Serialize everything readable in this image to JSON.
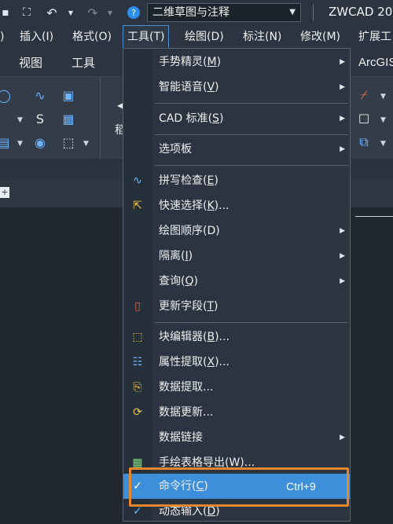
{
  "titlebar": {
    "workspace": "二维草图与注释",
    "app_title": "ZWCAD 20"
  },
  "menubar": {
    "items": [
      {
        "label": "插入(I)"
      },
      {
        "label": "格式(O)"
      },
      {
        "label": "工具(T)"
      },
      {
        "label": "绘图(D)"
      },
      {
        "label": "标注(N)"
      },
      {
        "label": "修改(M)"
      },
      {
        "label": "扩展工"
      }
    ]
  },
  "ribbon": {
    "tabs": [
      {
        "label": "视图"
      },
      {
        "label": "工具"
      },
      {
        "label": "ArcGIS"
      }
    ],
    "partial_label": "稻"
  },
  "tools_menu": {
    "items": [
      {
        "pre": "手势精灵(",
        "key": "M",
        "post": ")",
        "submenu": true
      },
      {
        "pre": "智能语音(",
        "key": "V",
        "post": ")",
        "submenu": true
      },
      {
        "pre": "CAD 标准(",
        "key": "S",
        "post": ")",
        "submenu": true
      },
      {
        "pre": "选项板",
        "key": "",
        "post": "",
        "submenu": true
      },
      {
        "pre": "拼写检查(",
        "key": "E",
        "post": ")",
        "icon": "spell-check-icon"
      },
      {
        "pre": "快速选择(",
        "key": "K",
        "post": ")...",
        "icon": "quick-select-icon"
      },
      {
        "pre": "绘图顺序(D)",
        "key": "",
        "post": "",
        "submenu": true
      },
      {
        "pre": "隔离(",
        "key": "I",
        "post": ")",
        "submenu": true
      },
      {
        "pre": "查询(",
        "key": "Q",
        "post": ")",
        "submenu": true
      },
      {
        "pre": "更新字段(",
        "key": "T",
        "post": ")",
        "icon": "update-field-icon"
      },
      {
        "pre": "块编辑器(",
        "key": "B",
        "post": ")...",
        "icon": "block-editor-icon"
      },
      {
        "pre": "属性提取(",
        "key": "X",
        "post": ")...",
        "icon": "attribute-extract-icon"
      },
      {
        "pre": "数据提取...",
        "key": "",
        "post": "",
        "icon": "data-extract-icon"
      },
      {
        "pre": "数据更新...",
        "key": "",
        "post": "",
        "icon": "data-update-icon"
      },
      {
        "pre": "数据链接",
        "key": "",
        "post": "",
        "submenu": true
      },
      {
        "pre": "手绘表格导出(W)...",
        "key": "",
        "post": "",
        "icon": "table-export-icon"
      },
      {
        "pre": "命令行(",
        "key": "C",
        "post": ")",
        "shortcut": "Ctrl+9",
        "checked": true
      },
      {
        "pre": "动态输入(",
        "key": "D",
        "post": ")",
        "checked": true
      }
    ]
  }
}
